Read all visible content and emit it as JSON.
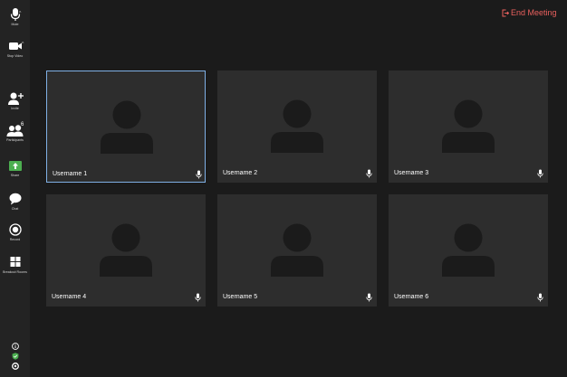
{
  "header": {
    "end_meeting_label": "End Meeting",
    "end_meeting_color": "#e9605e"
  },
  "sidebar": {
    "items": [
      {
        "id": "mute",
        "label": "Mute",
        "icon": "microphone-icon"
      },
      {
        "id": "stop-video",
        "label": "Stop Video",
        "icon": "video-camera-icon"
      },
      {
        "id": "invite",
        "label": "Invite",
        "icon": "add-user-icon"
      },
      {
        "id": "participants",
        "label": "Participants",
        "icon": "participants-icon",
        "badge": "6"
      },
      {
        "id": "share",
        "label": "Share",
        "icon": "share-screen-icon",
        "color": "#4caf50"
      },
      {
        "id": "chat",
        "label": "Chat",
        "icon": "chat-bubble-icon"
      },
      {
        "id": "record",
        "label": "Record",
        "icon": "record-icon"
      },
      {
        "id": "breakout-rooms",
        "label": "Breakout Rooms",
        "icon": "breakout-rooms-icon"
      }
    ],
    "bottom_icons": [
      "info-icon",
      "security-shield-icon",
      "settings-icon"
    ],
    "shield_color": "#4caf50"
  },
  "grid": {
    "active_border_color": "#7fb0e6",
    "tiles": [
      {
        "name": "Username 1",
        "active": true
      },
      {
        "name": "Username 2",
        "active": false
      },
      {
        "name": "Username 3",
        "active": false
      },
      {
        "name": "Username 4",
        "active": false
      },
      {
        "name": "Username 5",
        "active": false
      },
      {
        "name": "Username 6",
        "active": false
      }
    ]
  }
}
